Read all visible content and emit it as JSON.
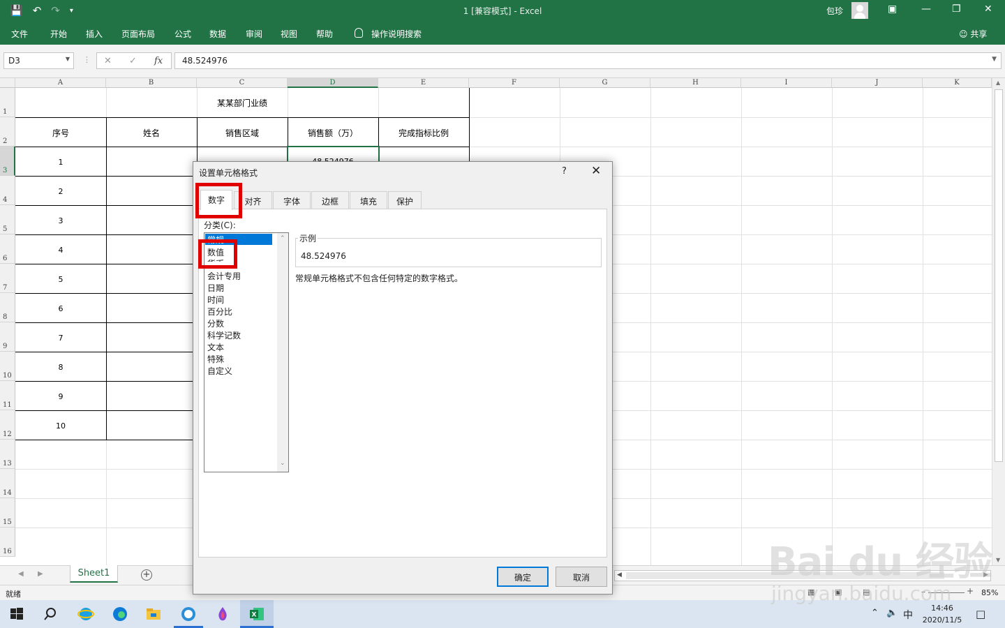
{
  "window": {
    "title": "1  [兼容模式]  -  Excel",
    "user": "包珍"
  },
  "ribbon": {
    "tabs": [
      "文件",
      "开始",
      "插入",
      "页面布局",
      "公式",
      "数据",
      "审阅",
      "视图",
      "帮助"
    ],
    "search": "操作说明搜索",
    "share": "共享"
  },
  "formula_bar": {
    "name_box": "D3",
    "fx": "fx",
    "value": "48.524976"
  },
  "sheet": {
    "columns": [
      "A",
      "B",
      "C",
      "D",
      "E",
      "F",
      "G",
      "H",
      "I",
      "J",
      "K"
    ],
    "rows": [
      "1",
      "2",
      "3",
      "4",
      "5",
      "6",
      "7",
      "8",
      "9",
      "10",
      "11",
      "12",
      "13",
      "14",
      "15",
      "16"
    ],
    "table_title": "某某部门业绩",
    "headers": [
      "序号",
      "姓名",
      "销售区域",
      "销售额（万）",
      "完成指标比例"
    ],
    "serials": [
      "1",
      "2",
      "3",
      "4",
      "5",
      "6",
      "7",
      "8",
      "9",
      "10"
    ],
    "d3_value": "48.524976"
  },
  "sheet_tabs": {
    "active": "Sheet1",
    "add": "+"
  },
  "status": {
    "ready": "就绪",
    "zoom": "85%"
  },
  "taskbar": {
    "time": "14:46",
    "date": "2020/11/5",
    "ime": "中"
  },
  "dialog": {
    "title": "设置单元格格式",
    "help": "?",
    "close": "✕",
    "tabs": [
      "数字",
      "对齐",
      "字体",
      "边框",
      "填充",
      "保护"
    ],
    "category_label": "分类(C):",
    "categories": [
      "常规",
      "数值",
      "货币",
      "会计专用",
      "日期",
      "时间",
      "百分比",
      "分数",
      "科学记数",
      "文本",
      "特殊",
      "自定义"
    ],
    "sample_label": "示例",
    "sample_value": "48.524976",
    "description": "常规单元格格式不包含任何特定的数字格式。",
    "ok": "确定",
    "cancel": "取消"
  },
  "watermark": {
    "line1": "Bai du 经验",
    "line2": "jingyan.baidu.com"
  },
  "colors": {
    "excel_green": "#217346",
    "highlight_red": "#e00000",
    "selection_blue": "#0078d7"
  }
}
